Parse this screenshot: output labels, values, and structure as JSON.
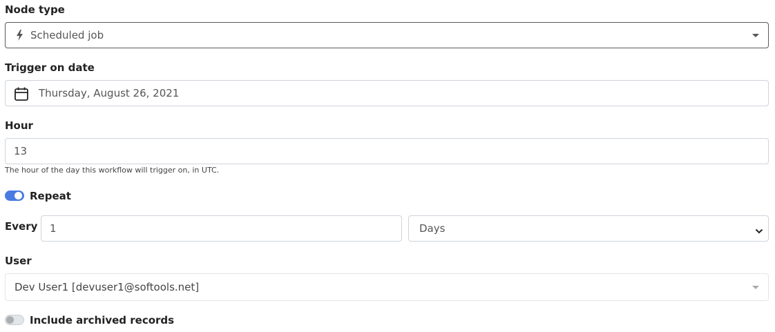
{
  "node_type": {
    "label": "Node type",
    "value": "Scheduled job",
    "icon": "bolt-icon"
  },
  "trigger_date": {
    "label": "Trigger on date",
    "value": "Thursday, August 26, 2021",
    "icon": "calendar-icon"
  },
  "hour": {
    "label": "Hour",
    "value": "13",
    "help": "The hour of the day this workflow will trigger on, in UTC."
  },
  "repeat": {
    "label": "Repeat",
    "enabled": true
  },
  "every": {
    "label": "Every",
    "value": "1",
    "unit": "Days"
  },
  "user": {
    "label": "User",
    "value": "Dev User1 [devuser1@softools.net]"
  },
  "include_archived": {
    "label": "Include archived records",
    "enabled": false
  },
  "colors": {
    "toggle_on": "#4a7bdf",
    "toggle_off": "#e3e6e9"
  }
}
